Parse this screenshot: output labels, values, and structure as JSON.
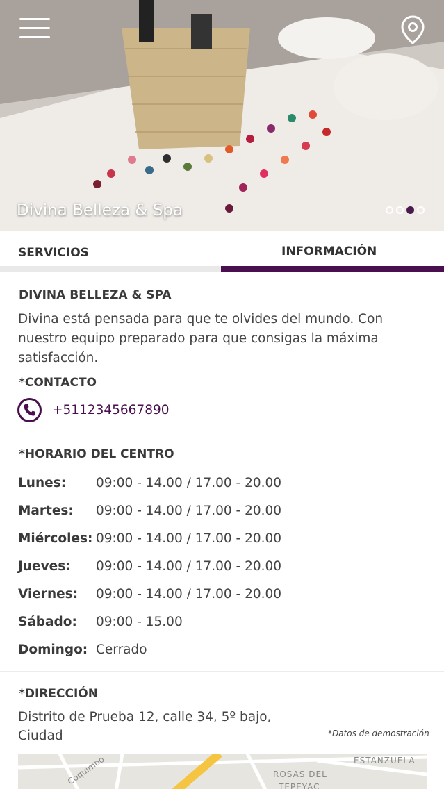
{
  "hero": {
    "title": "Divina Belleza & Spa",
    "slides": 4,
    "active_slide": 3
  },
  "tabs": [
    {
      "label": "SERVICIOS",
      "active": false
    },
    {
      "label": "INFORMACIÓN",
      "active": true
    }
  ],
  "about": {
    "title": "DIVINA BELLEZA & SPA",
    "description": "Divina está pensada para que te olvides del mundo. Con nuestro equipo preparado para que consigas la máxima satisfacción."
  },
  "contact": {
    "title": "*CONTACTO",
    "phone": "+5112345667890",
    "icon": "phone-icon"
  },
  "hours": {
    "title": "*HORARIO DEL CENTRO",
    "rows": [
      {
        "day": "Lunes:",
        "time": "09:00 - 14.00  /  17.00 - 20.00"
      },
      {
        "day": "Martes:",
        "time": "09:00 - 14.00  /  17.00 - 20.00"
      },
      {
        "day": "Miércoles:",
        "time": "09:00 - 14.00  /  17.00 - 20.00"
      },
      {
        "day": "Jueves:",
        "time": "09:00 - 14.00  /  17.00 - 20.00"
      },
      {
        "day": "Viernes:",
        "time": "09:00 - 14.00  /  17.00 - 20.00"
      },
      {
        "day": "Sábado:",
        "time": "09:00 - 15.00"
      },
      {
        "day": "Domingo:",
        "time": "Cerrado"
      }
    ]
  },
  "address": {
    "title": "*DIRECCIÓN",
    "text": "Distrito de Prueba 12, calle 34, 5º bajo, Ciudad",
    "note": "*Datos de demostración",
    "map_labels": [
      "Coquimbo",
      "ESTANZUELA",
      "ROSAS DEL",
      "TEPEYAC"
    ]
  },
  "colors": {
    "accent": "#4a0f4e",
    "tab_inactive_bar": "#e9e9e9",
    "text": "#444444"
  }
}
